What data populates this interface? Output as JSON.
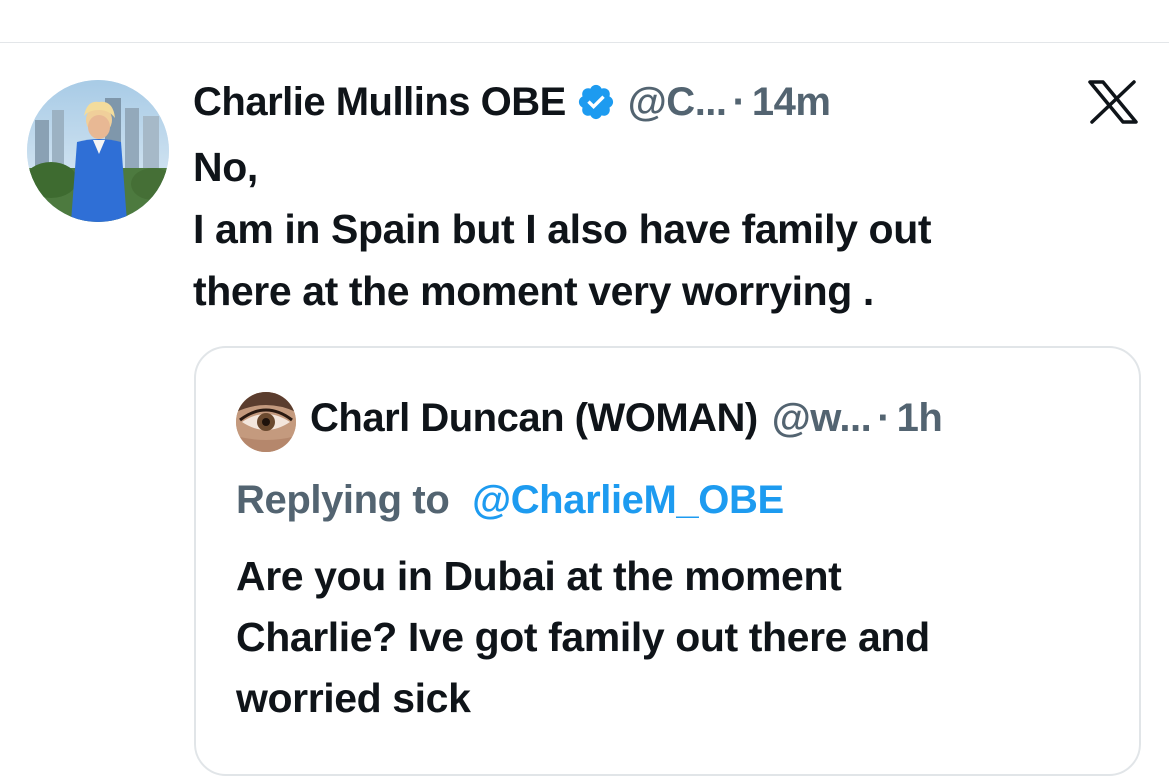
{
  "tweet": {
    "author": {
      "display_name": "Charlie Mullins OBE",
      "handle": "@C...",
      "verified": true,
      "time": "14m",
      "separator": "·"
    },
    "text_lines": [
      "No,",
      "I am in Spain but I also have family out",
      "there at the moment very worrying ."
    ]
  },
  "quoted_tweet": {
    "author": {
      "display_name": "Charl Duncan (WOMAN)",
      "handle": "@w...",
      "time": "1h",
      "separator": "·"
    },
    "replying_prefix": "Replying to",
    "replying_to": "@CharlieM_OBE",
    "text_lines": [
      "Are you in Dubai at the moment",
      "Charlie? Ive got family out there and",
      "worried sick"
    ]
  },
  "icons": {
    "verified": "verified-badge-icon",
    "brand": "x-logo-icon"
  },
  "colors": {
    "text_primary": "#0f1419",
    "text_secondary": "#536471",
    "accent": "#1d9bf0",
    "border": "#e1e5e8"
  }
}
